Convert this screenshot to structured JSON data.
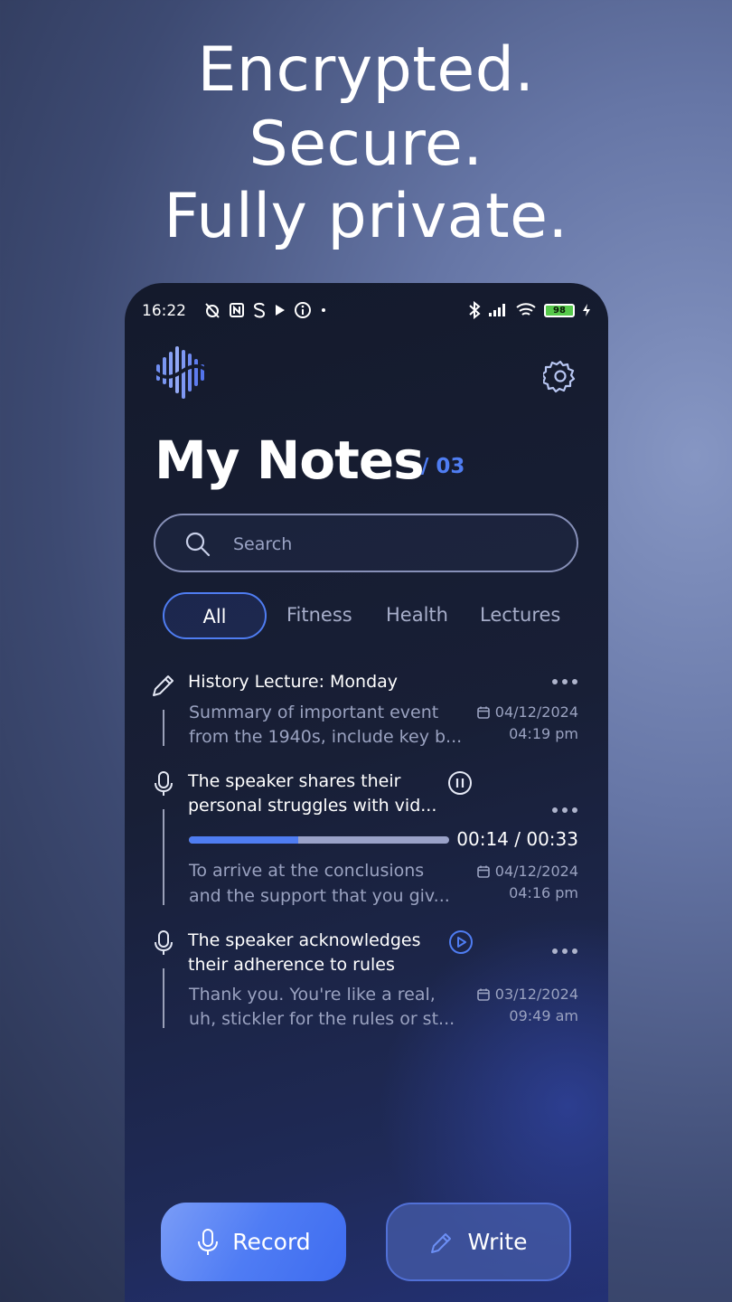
{
  "headline": {
    "line1": "Encrypted.",
    "line2": "Secure.",
    "line3": "Fully private."
  },
  "status_bar": {
    "time": "16:22",
    "battery": "98"
  },
  "header": {
    "title": "My Notes",
    "count": "/ 03"
  },
  "search": {
    "placeholder": "Search"
  },
  "tabs": [
    {
      "label": "All",
      "active": true
    },
    {
      "label": "Fitness",
      "active": false
    },
    {
      "label": "Health",
      "active": false
    },
    {
      "label": "Lectures",
      "active": false
    }
  ],
  "notes": [
    {
      "type": "text",
      "title": "History Lecture: Monday",
      "desc_line1": "Summary of important event",
      "desc_line2": "from the 1940s, include key b...",
      "date": "04/12/2024",
      "time": "04:19 pm"
    },
    {
      "type": "audio",
      "state": "playing",
      "title_line1": "The speaker shares their",
      "title_line2": "personal struggles with vid...",
      "progress": 0.42,
      "playback": "00:14 / 00:33",
      "desc_line1": "To arrive at the conclusions",
      "desc_line2": "and the support that you giv...",
      "date": "04/12/2024",
      "time": "04:16 pm"
    },
    {
      "type": "audio",
      "state": "paused",
      "title_line1": "The speaker acknowledges",
      "title_line2": "their adherence to rules",
      "desc_line1": "Thank you. You're like a real,",
      "desc_line2": "uh, stickler for the rules or st...",
      "date": "03/12/2024",
      "time": "09:49 am"
    }
  ],
  "actions": {
    "record_label": "Record",
    "write_label": "Write"
  },
  "colors": {
    "accent": "#4f7df2",
    "phone_bg": "#161c30",
    "muted_text": "#9aa2c0"
  }
}
